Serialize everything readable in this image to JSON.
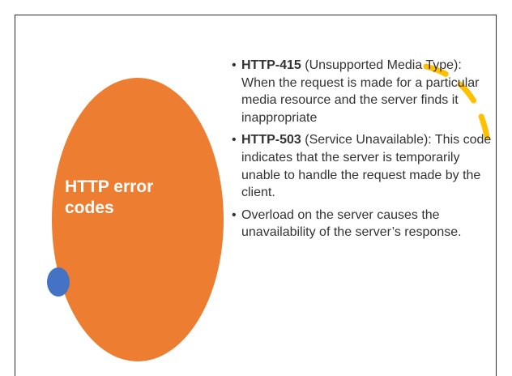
{
  "slide": {
    "title": "HTTP error\ncodes",
    "bullets": [
      {
        "code": "HTTP-415",
        "text": " (Unsupported Media Type): When the request is made for a particular media resource and the server finds it inappropriate"
      },
      {
        "code": "HTTP-503",
        "text": " (Service Unavailable): This code indicates that the server is temporarily unable to handle the request made by the client."
      },
      {
        "code": "",
        "text": "Overload on the server causes the unavailability of the server’s response."
      }
    ]
  },
  "colors": {
    "circle": "#ed7d31",
    "dot": "#4472c4",
    "arc": "#ffc000",
    "text": "#333333",
    "title": "#ffffff"
  }
}
